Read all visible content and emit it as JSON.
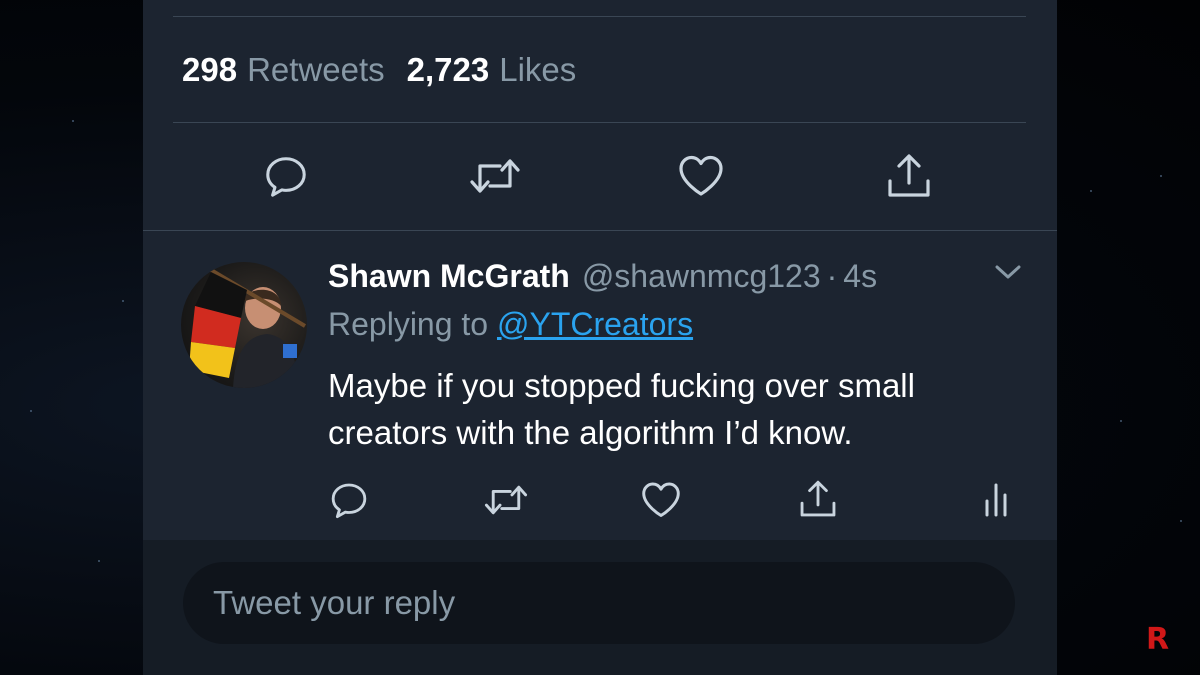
{
  "stats": {
    "retweets_count": "298",
    "retweets_label": "Retweets",
    "likes_count": "2,723",
    "likes_label": "Likes"
  },
  "main_actions": [
    {
      "name": "reply-icon"
    },
    {
      "name": "retweet-icon"
    },
    {
      "name": "like-icon"
    },
    {
      "name": "share-icon"
    }
  ],
  "reply_tweet": {
    "author_name": "Shawn McGrath",
    "author_handle": "@shawnmcg123",
    "separator": "·",
    "timestamp": "4s",
    "replying_prefix": "Replying to",
    "replying_to": "@YTCreators",
    "text": "Maybe if you stopped fucking over small creators with the algorithm I’d know.",
    "actions": [
      {
        "name": "reply-icon"
      },
      {
        "name": "retweet-icon"
      },
      {
        "name": "like-icon"
      },
      {
        "name": "share-icon"
      },
      {
        "name": "analytics-icon"
      }
    ]
  },
  "composer": {
    "placeholder": "Tweet your reply"
  },
  "watermark": "R",
  "colors": {
    "background": "#1c2430",
    "text_primary": "#ffffff",
    "text_secondary": "#8899a6",
    "link": "#2aa3ef",
    "watermark": "#d11818"
  }
}
